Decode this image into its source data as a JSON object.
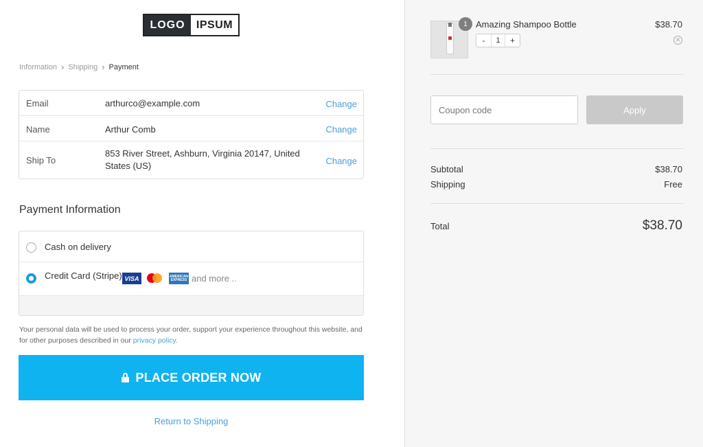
{
  "logo": {
    "part1": "LOGO",
    "part2": "IPSUM"
  },
  "breadcrumb": {
    "items": [
      "Information",
      "Shipping",
      "Payment"
    ]
  },
  "info": {
    "rows": [
      {
        "label": "Email",
        "value": "arthurco@example.com",
        "action": "Change"
      },
      {
        "label": "Name",
        "value": "Arthur Comb",
        "action": "Change"
      },
      {
        "label": "Ship To",
        "value": "853 River Street, Ashburn, Virginia 20147, United States (US)",
        "action": "Change"
      }
    ]
  },
  "payment": {
    "title": "Payment Information",
    "options": [
      {
        "label": "Cash on delivery",
        "selected": false
      },
      {
        "label": "Credit Card (Stripe)",
        "selected": true
      }
    ],
    "cards": {
      "visa": "VISA",
      "amex": "AMERICAN EXPRESS",
      "more": "and more .."
    }
  },
  "privacy": {
    "text": "Your personal data will be used to process your order, support your experience throughout this website, and for other purposes described in our ",
    "link": "privacy policy."
  },
  "place_order": "PLACE ORDER NOW",
  "return_link": "Return to Shipping",
  "cart": {
    "item": {
      "name": "Amazing Shampoo Bottle",
      "price": "$38.70",
      "quantity": "1",
      "badge": "1"
    },
    "stepper": {
      "minus": "-",
      "plus": "+"
    },
    "remove_icon": "circle-x-icon"
  },
  "coupon": {
    "placeholder": "Coupon code",
    "apply": "Apply"
  },
  "summary": {
    "subtotal_label": "Subtotal",
    "subtotal": "$38.70",
    "shipping_label": "Shipping",
    "shipping": "Free",
    "total_label": "Total",
    "total": "$38.70"
  },
  "colors": {
    "accent": "#0fb3f0",
    "link": "#4a9fd8",
    "radio": "#1a9ae2"
  }
}
